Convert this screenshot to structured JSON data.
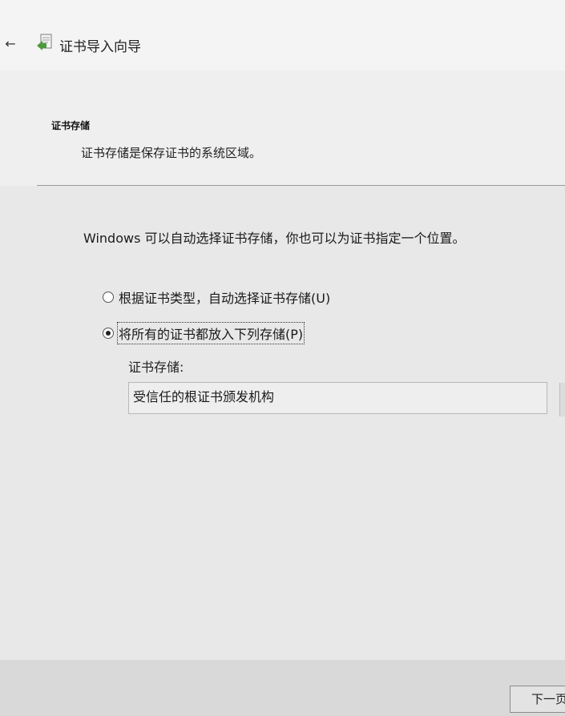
{
  "header": {
    "back_icon": "arrow-left-icon",
    "wizard_icon": "certificate-wizard-icon",
    "title": "证书导入向导"
  },
  "section": {
    "title": "证书存储",
    "description": "证书存储是保存证书的系统区域。"
  },
  "main": {
    "intro": "Windows 可以自动选择证书存储，你也可以为证书指定一个位置。",
    "options": [
      {
        "label": "根据证书类型，自动选择证书存储(U)",
        "checked": false
      },
      {
        "label": "将所有的证书都放入下列存储(P)",
        "checked": true
      }
    ],
    "store_label": "证书存储:",
    "store_value": "受信任的根证书颁发机构"
  },
  "footer": {
    "next_label": "下一页"
  }
}
